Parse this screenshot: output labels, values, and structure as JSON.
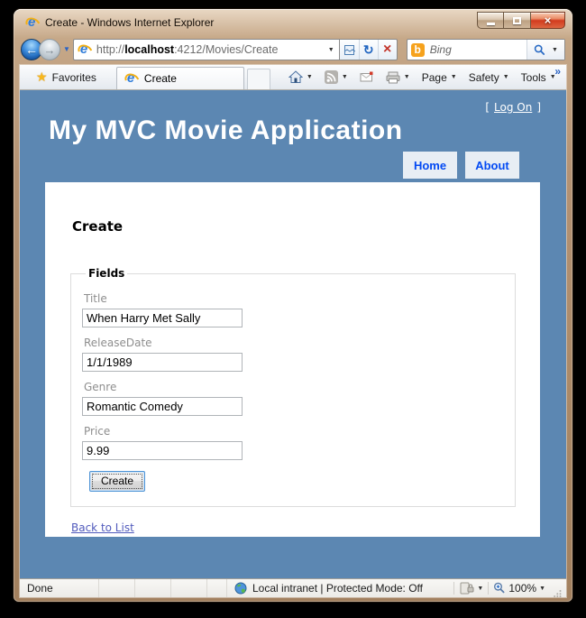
{
  "window": {
    "title": "Create - Windows Internet Explorer"
  },
  "browser": {
    "address": {
      "protocol": "http://",
      "host": "localhost",
      "path": ":4212/Movies/Create"
    },
    "search": {
      "engine": "Bing",
      "logo_letter": "b"
    },
    "favorites_label": "Favorites",
    "tab_title": "Create",
    "commands": {
      "page_label": "Page",
      "safety_label": "Safety",
      "tools_label": "Tools"
    }
  },
  "page": {
    "logon": {
      "open": "[",
      "label": "Log On",
      "close": "]"
    },
    "app_title": "My MVC Movie Application",
    "nav": [
      {
        "label": "Home"
      },
      {
        "label": "About"
      }
    ],
    "heading": "Create",
    "form": {
      "legend": "Fields",
      "fields": [
        {
          "label": "Title",
          "value": "When Harry Met Sally"
        },
        {
          "label": "ReleaseDate",
          "value": "1/1/1989"
        },
        {
          "label": "Genre",
          "value": "Romantic Comedy"
        },
        {
          "label": "Price",
          "value": "9.99"
        }
      ],
      "submit_label": "Create"
    },
    "back_link_label": "Back to List"
  },
  "statusbar": {
    "status": "Done",
    "zone": "Local intranet | Protected Mode: Off",
    "zoom_level": "100%"
  },
  "icons": {
    "ie_e": "e",
    "caret": "▼",
    "star": "★",
    "chevron": "»",
    "close_x": "×",
    "stop_x": "×",
    "refresh": "↻",
    "back_arrow": "←",
    "forward_arrow": "→"
  },
  "colors": {
    "page_background": "#5c87b2",
    "tab_background": "#e8eef4",
    "link_blue": "#034af3",
    "visited_link": "#505abc",
    "frame_tan": "#b19175",
    "bing_orange": "#f6a21d"
  }
}
